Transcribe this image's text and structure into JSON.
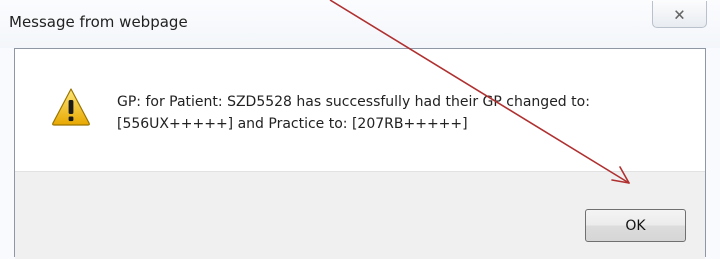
{
  "window": {
    "title": "Message from webpage",
    "close_label": "🗙"
  },
  "message": {
    "line1": "GP: for Patient: SZD5528 has successfully had their GP changed to:",
    "line2": "[556UX+++++] and Practice to: [207RB+++++]"
  },
  "buttons": {
    "ok_label": "OK"
  },
  "icons": {
    "message_icon": "warning-icon",
    "close_icon": "close-icon"
  },
  "colors": {
    "warning_fill": "#f5c400",
    "annotation_arrow": "#b03030"
  }
}
